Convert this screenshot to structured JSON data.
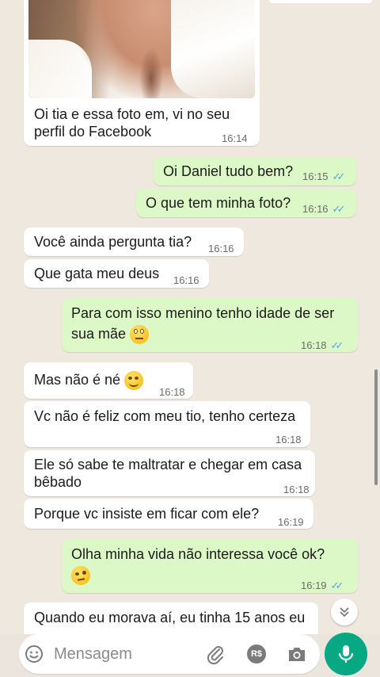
{
  "chat": {
    "photo_message": {
      "caption_line1": "Oi tia e essa foto em, vi no seu",
      "caption_line2": "perfil do Facebook",
      "time": "16:14"
    },
    "messages": [
      {
        "dir": "out",
        "text": "Oi Daniel tudo bem?",
        "time": "16:15"
      },
      {
        "dir": "out",
        "text": "O que tem minha foto?",
        "time": "16:16"
      },
      {
        "dir": "in",
        "text": "Você ainda pergunta tia?",
        "time": "16:16"
      },
      {
        "dir": "in",
        "text": "Que gata meu deus",
        "time": "16:16"
      },
      {
        "dir": "out",
        "text_line1": "Para com isso menino tenho idade de ser",
        "text_line2": "sua mãe",
        "emoji": "face-with-rolling-eyes-emoji",
        "time": "16:18"
      },
      {
        "dir": "in",
        "text": "Mas não é né",
        "emoji": "smiling-face-emoji",
        "time": "16:18"
      },
      {
        "dir": "in",
        "text": "Vc não é feliz com meu tio, tenho certeza",
        "time": "16:18"
      },
      {
        "dir": "in",
        "text_line1": "Ele só sabe te maltratar e chegar em casa",
        "text_line2": "bêbado",
        "time": "16:18"
      },
      {
        "dir": "in",
        "text": "Porque vc insiste em ficar com ele?",
        "time": "16:19"
      },
      {
        "dir": "out",
        "text": "Olha minha vida não interessa você ok?",
        "emoji": "face-with-raised-eyebrow-emoji",
        "time": "16:19"
      },
      {
        "dir": "in",
        "text": "Quando eu morava aí, eu tinha 15 anos eu",
        "time": ""
      }
    ]
  },
  "composer": {
    "placeholder": "Mensagem",
    "emoji_icon": "smiley-icon",
    "attach_icon": "paperclip-icon",
    "payment_icon": "rupee-payment-icon",
    "payment_label": "R$",
    "camera_icon": "camera-icon",
    "mic_icon": "microphone-icon"
  },
  "colors": {
    "incoming_bubble": "#ffffff",
    "outgoing_bubble": "#dcf8c6",
    "read_ticks": "#4fa8e0",
    "mic_button": "#07a884",
    "chat_background": "#efe8df"
  }
}
